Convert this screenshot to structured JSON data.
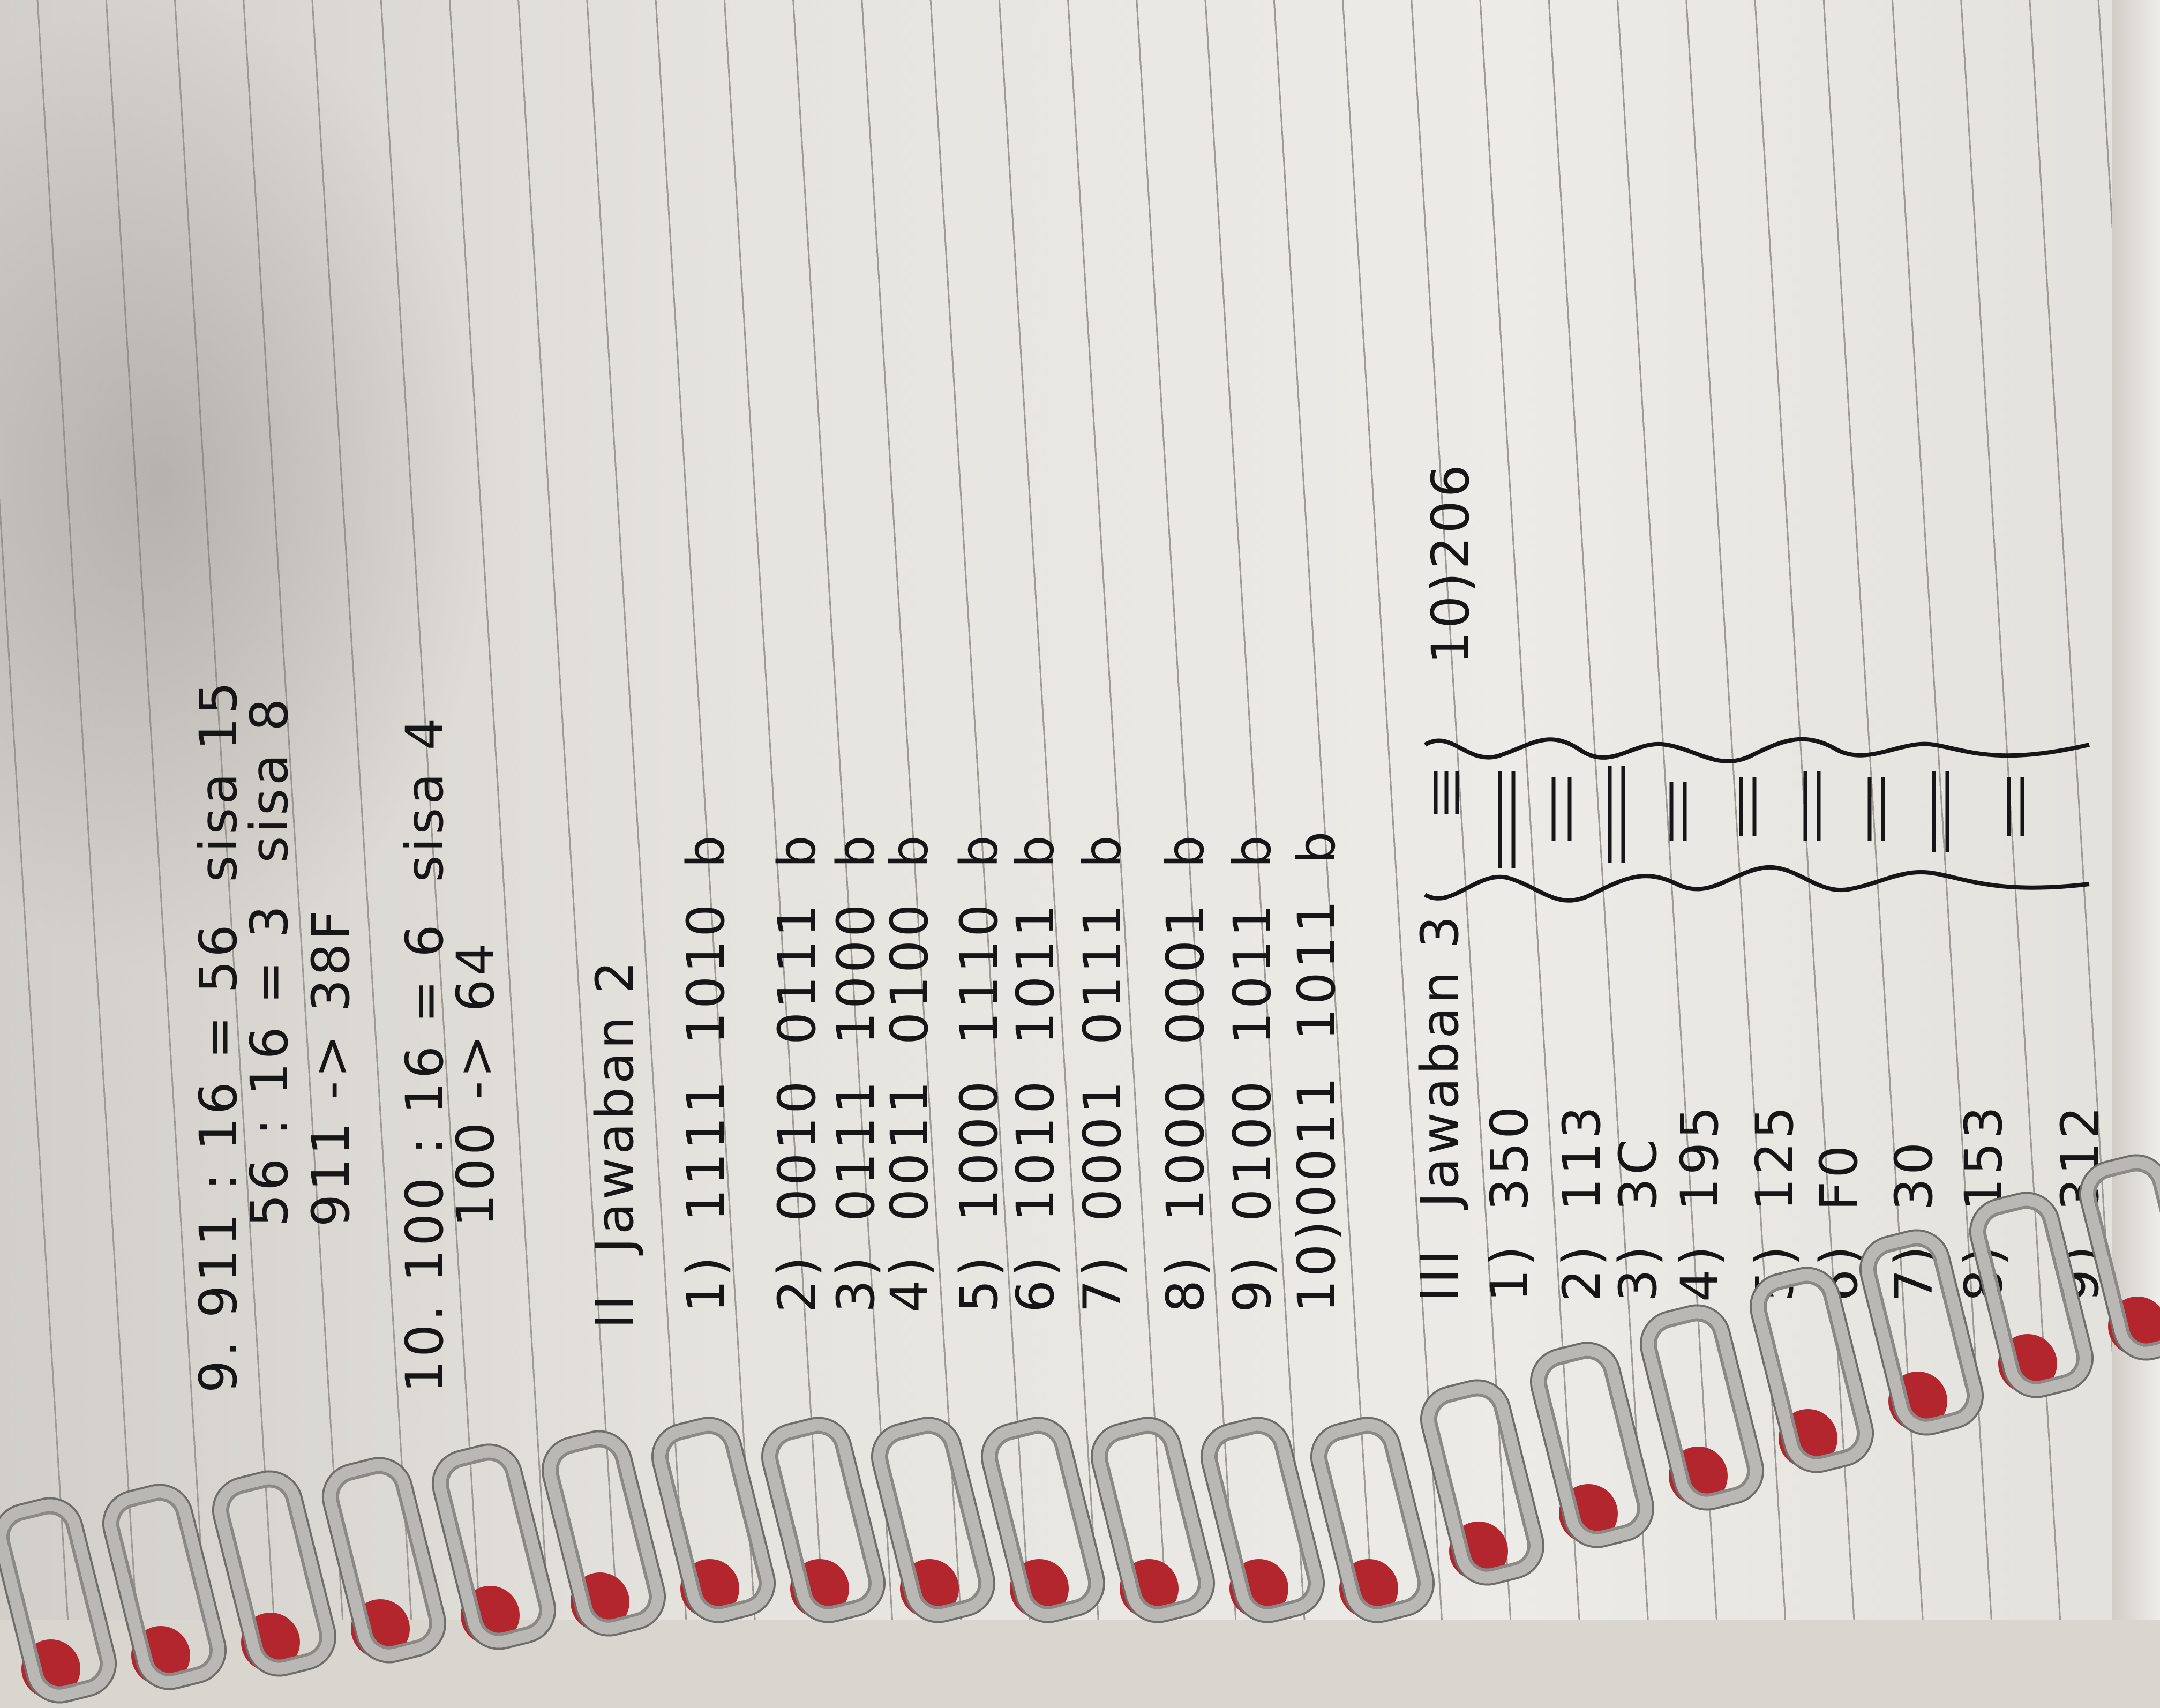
{
  "section_1_tail": {
    "problem_9": {
      "line1": "9. 911 : 16 = 56  sisa 15",
      "line2": "56 : 16 = 3  sisa 8",
      "line3": "911 -> 38F"
    },
    "problem_10": {
      "line1": "10. 100 : 16 = 6  sisa 4",
      "line2": "100 -> 64"
    }
  },
  "section_2": {
    "heading": "II  Jawaban 2",
    "rows": [
      {
        "label": "1)",
        "high": "1111",
        "low": "1010",
        "suffix": "b"
      },
      {
        "label": "2)",
        "high": "0010",
        "low": "0111",
        "suffix": "b"
      },
      {
        "label": "3)",
        "high": "0111",
        "low": "1000",
        "suffix": "b"
      },
      {
        "label": "4)",
        "high": "0011",
        "low": "0100",
        "suffix": "b"
      },
      {
        "label": "5)",
        "high": "1000",
        "low": "1110",
        "suffix": "b"
      },
      {
        "label": "6)",
        "high": "1010",
        "low": "1011",
        "suffix": "b"
      },
      {
        "label": "7)",
        "high": "0001",
        "low": "0111",
        "suffix": "b"
      },
      {
        "label": "8)",
        "high": "1000",
        "low": "0001",
        "suffix": "b"
      },
      {
        "label": "9)",
        "high": "0100",
        "low": "1011",
        "suffix": "b"
      },
      {
        "label": "10)",
        "high": "0011",
        "low": "1011",
        "suffix": "b"
      }
    ]
  },
  "section_3": {
    "heading": "III  Jawaban 3",
    "rows": [
      {
        "label": "1)",
        "value": "350"
      },
      {
        "label": "2)",
        "value": "113"
      },
      {
        "label": "3)",
        "value": "3C"
      },
      {
        "label": "4)",
        "value": "195"
      },
      {
        "label": "5)",
        "value": "125"
      },
      {
        "label": "6)",
        "value": "F0"
      },
      {
        "label": "7)",
        "value": "30"
      },
      {
        "label": "8)",
        "value": "153"
      },
      {
        "label": "9)",
        "value": "312"
      },
      {
        "label": "10)",
        "value": "206"
      }
    ]
  },
  "colors": {
    "ink": "#161616",
    "paper": "#eceae6",
    "binding_red": "#b3262e",
    "ring_silver": "#b9b8b4"
  }
}
